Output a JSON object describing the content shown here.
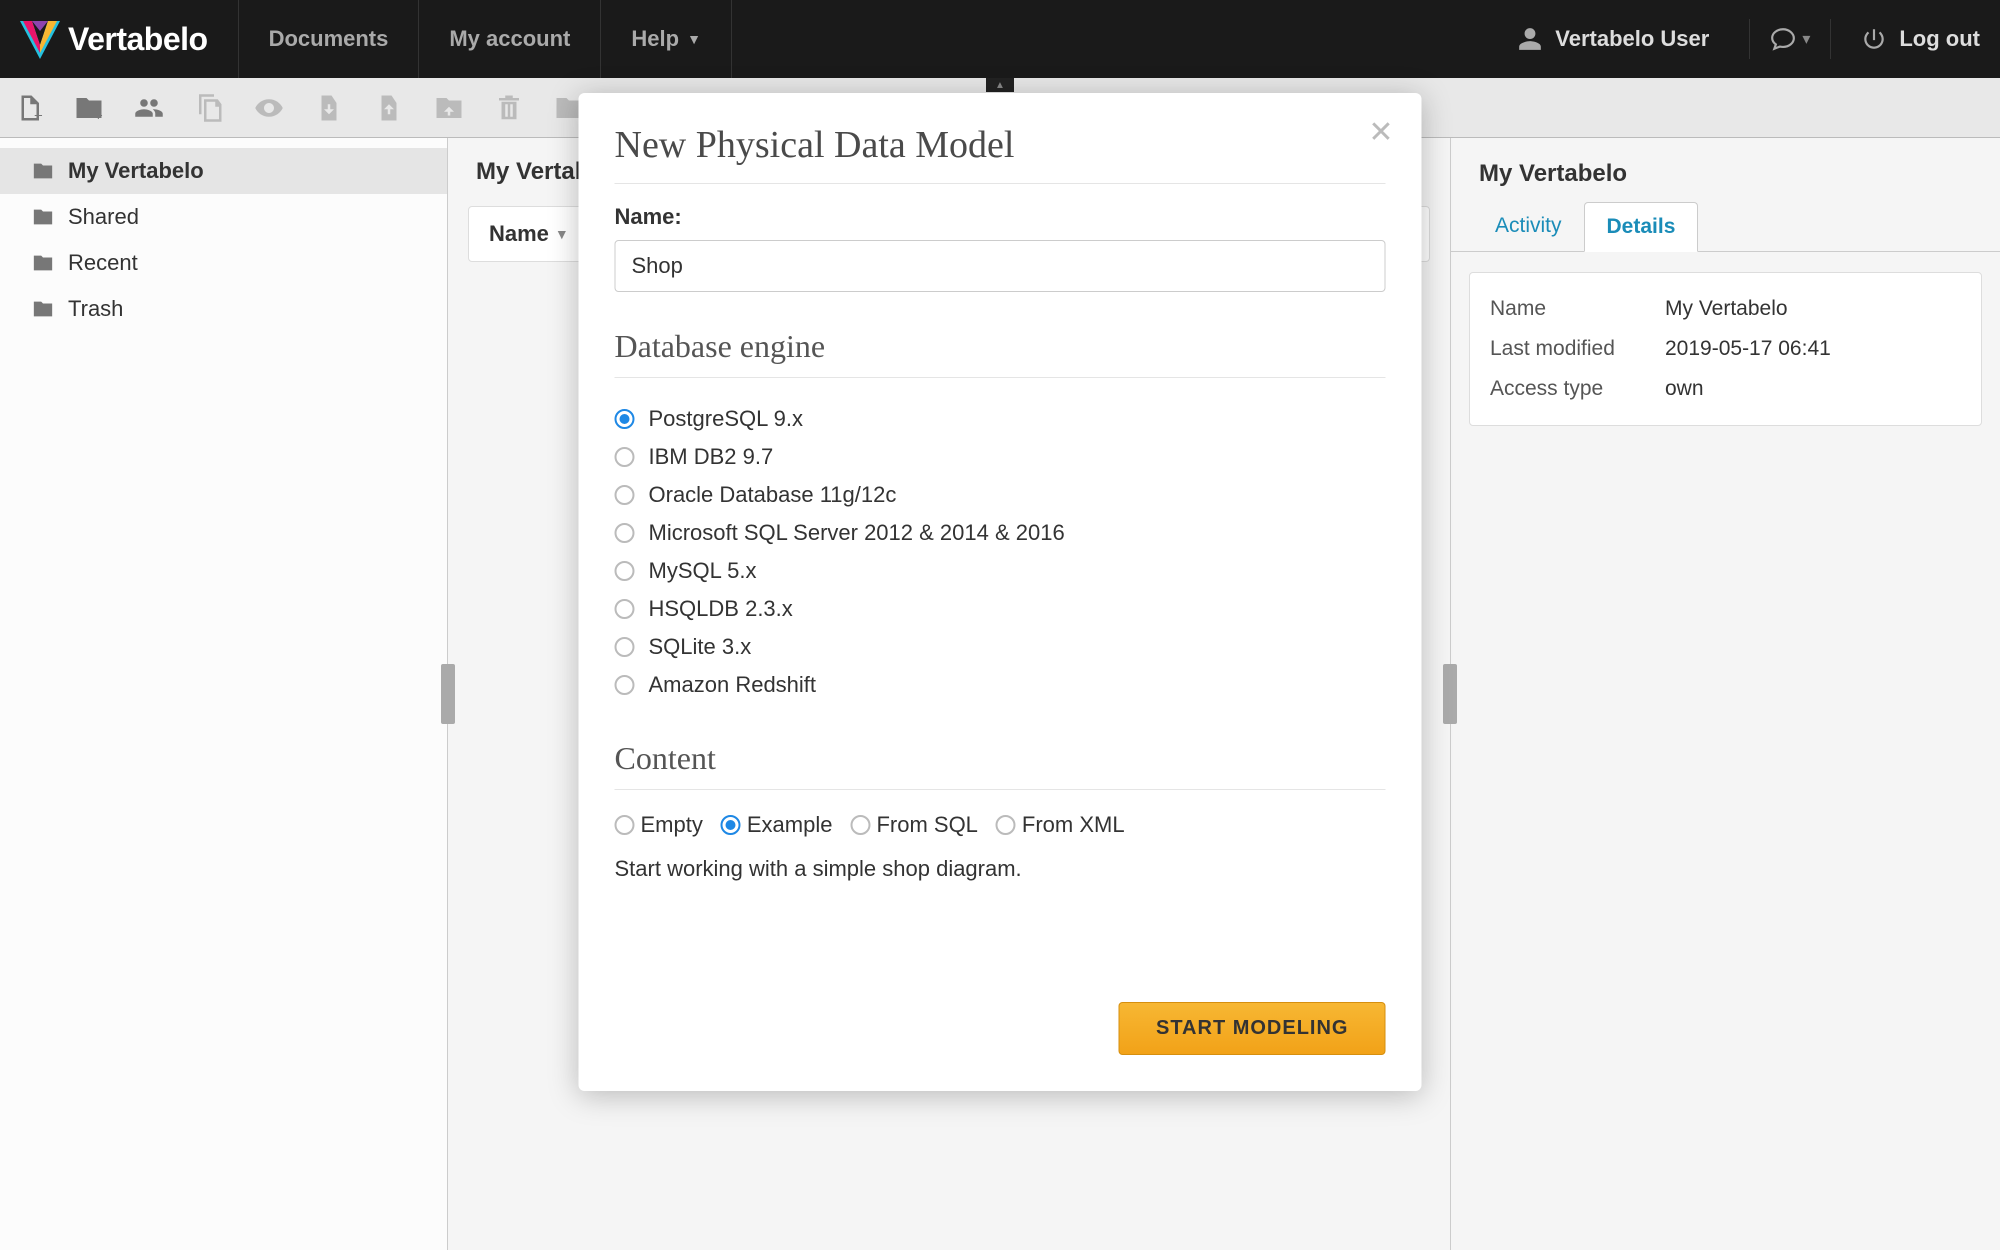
{
  "navbar": {
    "brand": "Vertabelo",
    "items": [
      "Documents",
      "My account",
      "Help"
    ],
    "user": "Vertabelo User",
    "logout": "Log out"
  },
  "sidebar": {
    "folders": [
      {
        "label": "My Vertabelo",
        "active": true
      },
      {
        "label": "Shared",
        "active": false
      },
      {
        "label": "Recent",
        "active": false
      },
      {
        "label": "Trash",
        "active": false
      }
    ]
  },
  "middle": {
    "breadcrumb": "My Vertabelo",
    "col_name": "Name"
  },
  "right": {
    "title": "My Vertabelo",
    "tabs": {
      "activity": "Activity",
      "details": "Details"
    },
    "details": [
      {
        "label": "Name",
        "value": "My Vertabelo"
      },
      {
        "label": "Last modified",
        "value": "2019-05-17 06:41"
      },
      {
        "label": "Access type",
        "value": "own"
      }
    ]
  },
  "modal": {
    "title": "New Physical Data Model",
    "name_label": "Name:",
    "name_value": "Shop",
    "db_header": "Database engine",
    "engines": [
      {
        "label": "PostgreSQL 9.x",
        "checked": true
      },
      {
        "label": "IBM DB2 9.7",
        "checked": false
      },
      {
        "label": "Oracle Database 11g/12c",
        "checked": false
      },
      {
        "label": "Microsoft SQL Server 2012 & 2014 & 2016",
        "checked": false
      },
      {
        "label": "MySQL 5.x",
        "checked": false
      },
      {
        "label": "HSQLDB 2.3.x",
        "checked": false
      },
      {
        "label": "SQLite 3.x",
        "checked": false
      },
      {
        "label": "Amazon Redshift",
        "checked": false
      }
    ],
    "content_header": "Content",
    "content_options": [
      {
        "label": "Empty",
        "checked": false
      },
      {
        "label": "Example",
        "checked": true
      },
      {
        "label": "From SQL",
        "checked": false
      },
      {
        "label": "From XML",
        "checked": false
      }
    ],
    "content_desc": "Start working with a simple shop diagram.",
    "primary_btn": "START MODELING"
  }
}
